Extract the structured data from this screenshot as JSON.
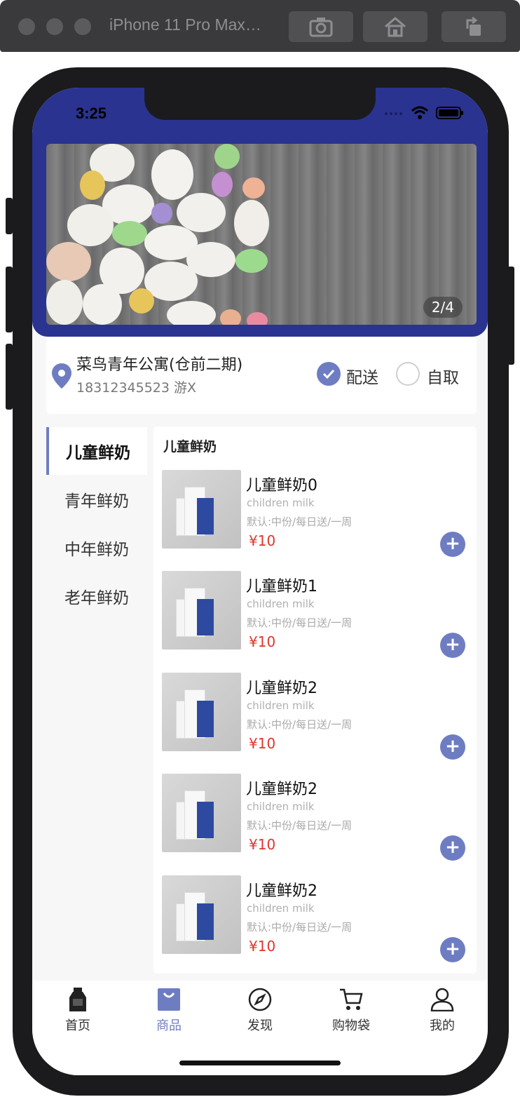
{
  "window": {
    "title": "iPhone 11 Pro Max…"
  },
  "status_bar": {
    "time": "3:25"
  },
  "banner": {
    "counter": "2/4"
  },
  "address": {
    "name": "菜鸟青年公寓(仓前二期)",
    "contact": "18312345523 游X",
    "options": [
      {
        "label": "配送",
        "selected": true
      },
      {
        "label": "自取",
        "selected": false
      }
    ]
  },
  "categories": [
    {
      "label": "儿童鲜奶",
      "active": true
    },
    {
      "label": "青年鲜奶",
      "active": false
    },
    {
      "label": "中年鲜奶",
      "active": false
    },
    {
      "label": "老年鲜奶",
      "active": false
    }
  ],
  "product_panel": {
    "title": "儿童鲜奶",
    "items": [
      {
        "name": "儿童鲜奶0",
        "subtitle": "children milk",
        "spec": "默认:中份/每日送/一周",
        "price": "¥10"
      },
      {
        "name": "儿童鲜奶1",
        "subtitle": "children milk",
        "spec": "默认:中份/每日送/一周",
        "price": "¥10"
      },
      {
        "name": "儿童鲜奶2",
        "subtitle": "children milk",
        "spec": "默认:中份/每日送/一周",
        "price": "¥10"
      },
      {
        "name": "儿童鲜奶2",
        "subtitle": "children milk",
        "spec": "默认:中份/每日送/一周",
        "price": "¥10"
      },
      {
        "name": "儿童鲜奶2",
        "subtitle": "children milk",
        "spec": "默认:中份/每日送/一周",
        "price": "¥10"
      }
    ]
  },
  "tabbar": {
    "tabs": [
      {
        "label": "首页",
        "icon": "milk-bottle-icon",
        "active": false
      },
      {
        "label": "商品",
        "icon": "shopping-bag-icon",
        "active": true
      },
      {
        "label": "发现",
        "icon": "compass-icon",
        "active": false
      },
      {
        "label": "购物袋",
        "icon": "cart-icon",
        "active": false
      },
      {
        "label": "我的",
        "icon": "user-icon",
        "active": false
      }
    ]
  },
  "colors": {
    "header": "#2a3390",
    "accent": "#6e7dc2",
    "price": "#e0362d"
  }
}
